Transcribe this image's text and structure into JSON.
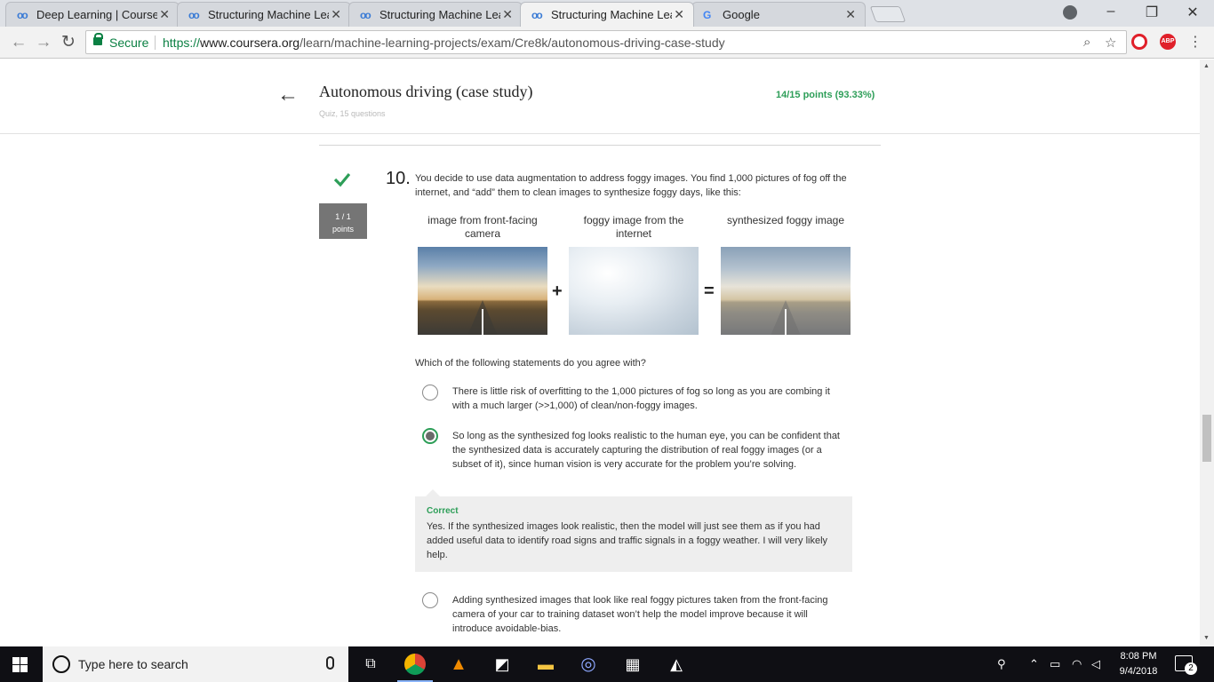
{
  "browser": {
    "tabs": [
      {
        "title": "Deep Learning | Coursera",
        "icon": "coursera-icon"
      },
      {
        "title": "Structuring Machine Lear",
        "icon": "coursera-icon"
      },
      {
        "title": "Structuring Machine Lear",
        "icon": "coursera-icon"
      },
      {
        "title": "Structuring Machine Lear",
        "icon": "coursera-icon",
        "active": true
      },
      {
        "title": "Google",
        "icon": "google-icon"
      }
    ],
    "secure_label": "Secure",
    "url_scheme": "https://",
    "url_host": "www.coursera.org",
    "url_path": "/learn/machine-learning-projects/exam/Cre8k/autonomous-driving-case-study"
  },
  "quiz": {
    "title": "Autonomous driving (case study)",
    "subtitle": "Quiz, 15 questions",
    "score": "14/15 points (93.33%)"
  },
  "question": {
    "number": "10.",
    "points_line1": "1 / 1",
    "points_line2": "points",
    "text": "You decide to use data augmentation to address foggy images. You find 1,000 pictures of fog off the internet, and “add” them to clean images to synthesize foggy days, like this:",
    "figure": {
      "captions": [
        "image from front-facing camera",
        "foggy image from the internet",
        "synthesized foggy image"
      ],
      "plus": "+",
      "equals": "="
    },
    "prompt": "Which of the following statements do you agree with?",
    "options": [
      {
        "text": "There is little risk of overfitting to the 1,000 pictures of fog so long as you are combing it with a much larger (>>1,000) of clean/non-foggy images.",
        "selected": false
      },
      {
        "text": "So long as the synthesized fog looks realistic to the human eye, you can be confident that the synthesized data is accurately capturing the distribution of real foggy images (or a subset of it), since human vision is very accurate for the problem you’re solving.",
        "selected": true
      },
      {
        "text": "Adding synthesized images that look like real foggy pictures taken from the front-facing camera of your car to training dataset won’t help the model improve because it will introduce avoidable-bias.",
        "selected": false
      }
    ],
    "feedback": {
      "title": "Correct",
      "text": "Yes. If the synthesized images look realistic, then the model will just see them as if you had added useful data to identify road signs and traffic signals in a foggy weather. I will very likely help."
    }
  },
  "taskbar": {
    "search_placeholder": "Type here to search",
    "time": "8:08 PM",
    "date": "9/4/2018",
    "notification_count": "2"
  },
  "colors": {
    "accent_green": "#2d9e58",
    "points_box": "#757575",
    "feedback_bg": "#eeeeee"
  }
}
